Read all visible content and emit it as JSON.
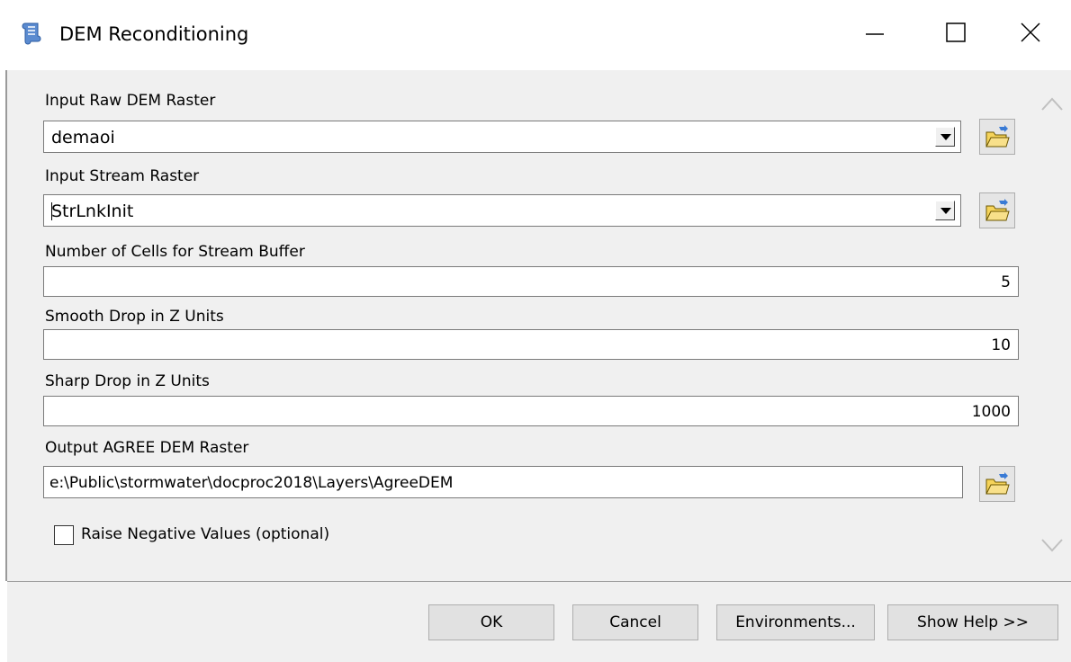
{
  "window": {
    "title": "DEM Reconditioning",
    "icon": "python-script-icon",
    "controls": [
      "minimize-icon",
      "maximize-icon",
      "close-icon"
    ]
  },
  "fields": {
    "raw_dem": {
      "label": "Input Raw DEM Raster",
      "value": "demaoi"
    },
    "stream": {
      "label": "Input Stream Raster",
      "value": "StrLnkInit"
    },
    "buffer": {
      "label": "Number of Cells for Stream Buffer",
      "value": "5"
    },
    "smooth": {
      "label": "Smooth Drop in Z Units",
      "value": "10"
    },
    "sharp": {
      "label": "Sharp Drop in Z Units",
      "value": "1000"
    },
    "output": {
      "label": "Output AGREE DEM Raster",
      "value": "e:\\Public\\stormwater\\docproc2018\\Layers\\AgreeDEM"
    }
  },
  "checkbox": {
    "label": "Raise Negative Values (optional)",
    "checked": false
  },
  "buttons": {
    "ok": "OK",
    "cancel": "Cancel",
    "environments": "Environments...",
    "help": "Show Help >>"
  },
  "colors": {
    "dialog_bg": "#f0f0f0",
    "folder_yellow": "#f5d35a"
  }
}
